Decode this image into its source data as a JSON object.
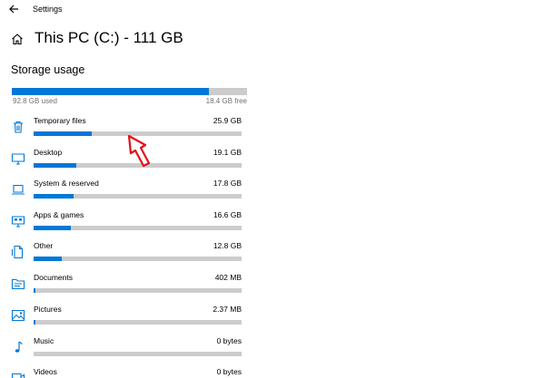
{
  "window": {
    "title": "Settings",
    "back_icon": "back-arrow-icon"
  },
  "header": {
    "home_icon": "home-icon",
    "title": "This PC (C:) - 111 GB"
  },
  "storage": {
    "section_title": "Storage usage",
    "used_label": "92.8 GB used",
    "free_label": "18.4 GB free",
    "used_fraction": 0.836,
    "accent_color": "#0078d7",
    "track_color": "#cccccc"
  },
  "categories": [
    {
      "name": "Temporary files",
      "size": "25.9 GB",
      "fraction": 0.28,
      "icon": "trash-icon"
    },
    {
      "name": "Desktop",
      "size": "19.1 GB",
      "fraction": 0.205,
      "icon": "monitor-icon"
    },
    {
      "name": "System & reserved",
      "size": "17.8 GB",
      "fraction": 0.19,
      "icon": "laptop-icon"
    },
    {
      "name": "Apps & games",
      "size": "16.6 GB",
      "fraction": 0.178,
      "icon": "apps-icon"
    },
    {
      "name": "Other",
      "size": "12.8 GB",
      "fraction": 0.137,
      "icon": "document-icon"
    },
    {
      "name": "Documents",
      "size": "402 MB",
      "fraction": 0.008,
      "icon": "folder-icon"
    },
    {
      "name": "Pictures",
      "size": "2.37 MB",
      "fraction": 0.002,
      "icon": "picture-icon"
    },
    {
      "name": "Music",
      "size": "0 bytes",
      "fraction": 0,
      "icon": "music-icon"
    },
    {
      "name": "Videos",
      "size": "0 bytes",
      "fraction": 0,
      "icon": "video-icon"
    }
  ],
  "annotation": {
    "icon": "pointer-arrow-icon",
    "color": "#e3101a"
  }
}
